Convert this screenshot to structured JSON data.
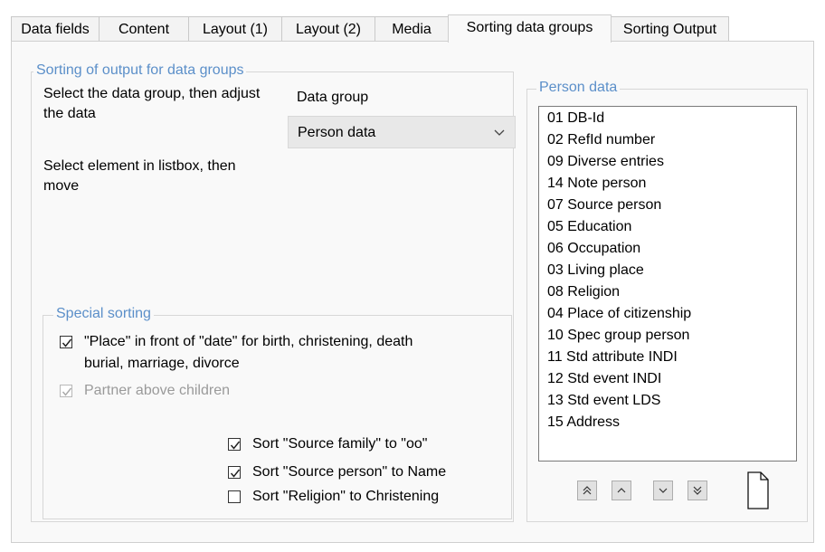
{
  "tabs": [
    {
      "label": "Data fields"
    },
    {
      "label": "Content"
    },
    {
      "label": "Layout (1)"
    },
    {
      "label": "Layout (2)"
    },
    {
      "label": "Media"
    },
    {
      "label": "Sorting data groups",
      "active": true
    },
    {
      "label": "Sorting Output"
    }
  ],
  "sorting_group": {
    "title": "Sorting of output for data groups",
    "instruction1": "Select the data group, then adjust the data",
    "instruction2": "Select element in listbox, then move",
    "data_group_label": "Data group",
    "data_group_value": "Person data"
  },
  "special_sorting": {
    "title": "Special sorting",
    "place_before_date": {
      "label_line1": "\"Place\" in front of \"date\" for birth, christening, death",
      "label_line2": "burial, marriage, divorce",
      "checked": true
    },
    "partner_above_children": {
      "label": "Partner above children",
      "checked": true,
      "disabled": true
    },
    "sort_source_family": {
      "label": "Sort \"Source family\" to \"oo\"",
      "checked": true
    },
    "sort_source_person": {
      "label": "Sort \"Source person\" to Name",
      "checked": true
    },
    "sort_religion": {
      "label": "Sort \"Religion\" to Christening",
      "checked": false
    }
  },
  "person_data": {
    "title": "Person data",
    "items": [
      "01 DB-Id",
      "02 RefId number",
      "09 Diverse entries",
      "14 Note person",
      "07 Source person",
      "05 Education",
      "06 Occupation",
      "03 Living place",
      "08 Religion",
      "04 Place of citizenship",
      "10 Spec group person",
      "11 Std attribute INDI",
      "12 Std event INDI",
      "13 Std event LDS",
      "15 Address"
    ]
  },
  "icons": {
    "move_top": "double-chevron-up-icon",
    "move_up": "chevron-up-icon",
    "move_down": "chevron-down-icon",
    "move_bottom": "double-chevron-down-icon",
    "new_document": "new-document-icon",
    "dropdown": "chevron-down-icon"
  },
  "colors": {
    "group_title": "#5b8fc9",
    "disabled_text": "#9a9a9a"
  }
}
